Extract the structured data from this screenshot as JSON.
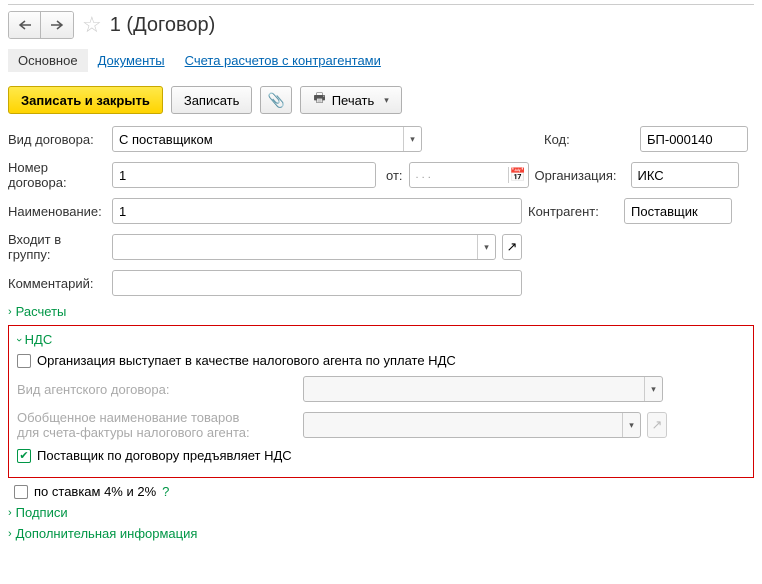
{
  "title": "1 (Договор)",
  "tabs": {
    "main": "Основное",
    "docs": "Документы",
    "accounts": "Счета расчетов с контрагентами"
  },
  "toolbar": {
    "save_close": "Записать и закрыть",
    "save": "Записать",
    "print": "Печать"
  },
  "labels": {
    "contract_type": "Вид договора:",
    "code": "Код:",
    "number": "Номер договора:",
    "from": "от:",
    "org": "Организация:",
    "name": "Наименование:",
    "counterparty": "Контрагент:",
    "group": "Входит в группу:",
    "comment": "Комментарий:",
    "agent_type": "Вид агентского договора:",
    "goods_name_1": "Обобщенное наименование товаров",
    "goods_name_2": "для счета-фактуры налогового агента:"
  },
  "values": {
    "contract_type": "С поставщиком",
    "code": "БП-000140",
    "number": "1",
    "date_ph": ".   .   .",
    "org": "ИКС",
    "name": "1",
    "counterparty": "Поставщик",
    "group": "",
    "comment": "",
    "agent_type": "",
    "goods_name": ""
  },
  "sections": {
    "calc": "Расчеты",
    "nds": "НДС",
    "sign": "Подписи",
    "extra": "Дополнительная информация"
  },
  "checks": {
    "tax_agent": "Организация выступает в качестве налогового агента по уплате НДС",
    "supplier_nds": "Поставщик по договору предъявляет НДС",
    "rates": "по ставкам 4% и 2%"
  }
}
